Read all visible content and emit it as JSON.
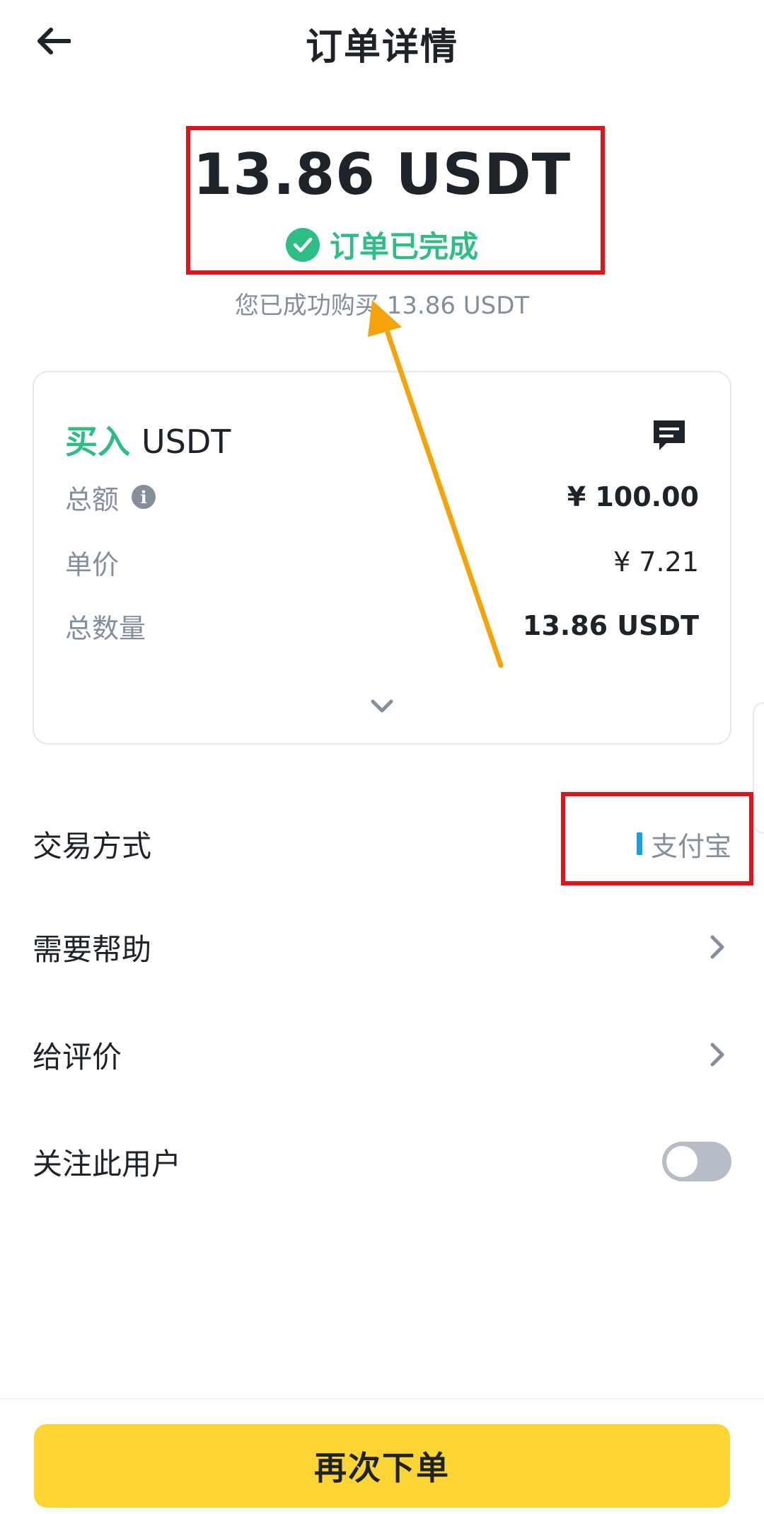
{
  "header": {
    "title": "订单详情",
    "back_icon": "arrow-left-icon"
  },
  "summary": {
    "amount": "13.86 USDT",
    "status": "订单已完成",
    "success_message": "您已成功购买 13.86 USDT",
    "status_color": "#2ebd85"
  },
  "card": {
    "side_label": "买入",
    "asset": "USDT",
    "rows": [
      {
        "label": "总额",
        "value": "¥ 100.00"
      },
      {
        "label": "单价",
        "value": "¥ 7.21"
      },
      {
        "label": "总数量",
        "value": "13.86 USDT"
      }
    ]
  },
  "list": {
    "payment_label": "交易方式",
    "payment_value": "支付宝",
    "help_label": "需要帮助",
    "review_label": "给评价",
    "follow_label": "关注此用户",
    "follow_enabled": false
  },
  "footer": {
    "reorder_label": "再次下单",
    "accent_color": "#fcd535"
  },
  "annotation_colors": {
    "highlight_box": "#e0121a",
    "arrow": "#f5a30a"
  }
}
